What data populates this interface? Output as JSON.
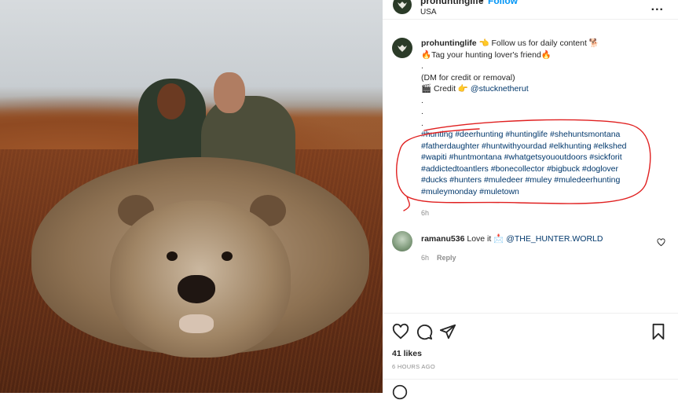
{
  "header": {
    "username": "prohuntinglife",
    "separator": "•",
    "follow_label": "Follow",
    "location": "USA",
    "more_label": "..."
  },
  "caption": {
    "username": "prohuntinglife",
    "line1_text": "👈 Follow us for daily content 🐕",
    "line2_text": "🔥Tag your hunting lover's friend🔥",
    "dot1": ".",
    "line4_text": "(DM for credit or removal)",
    "credit_prefix": "🎬 Credit 👉",
    "credit_mention": "@stucknetherut",
    "dot2": ".",
    "dot3": ".",
    "dot4": ".",
    "hashtag_lines": [
      "#hunting #deerhunting #huntinglife #shehuntsmontana",
      "#fatherdaughter #huntwithyourdad #elkhunting #elkshed",
      "#wapiti #huntmontana #whatgetsyououtdoors #sickforit",
      "#addictedtoantlers #bonecollector #bigbuck #doglover",
      "#ducks #hunters #muledeer #muley #muledeerhunting",
      "#muleymonday #muletown"
    ],
    "time": "6h"
  },
  "comment": {
    "username": "ramanu536",
    "text": "Love it 📩",
    "mention": "@THE_HUNTER.WORLD",
    "time": "6h",
    "reply_label": "Reply"
  },
  "actions": {
    "icons": [
      "heart-icon",
      "comment-icon",
      "share-icon",
      "bookmark-icon"
    ]
  },
  "stats": {
    "likes": "41 likes",
    "time_ago": "6 HOURS AGO"
  },
  "colors": {
    "link": "#00376b",
    "follow": "#0095f6",
    "annotation": "#e02020",
    "muted": "#8e8e8e"
  }
}
